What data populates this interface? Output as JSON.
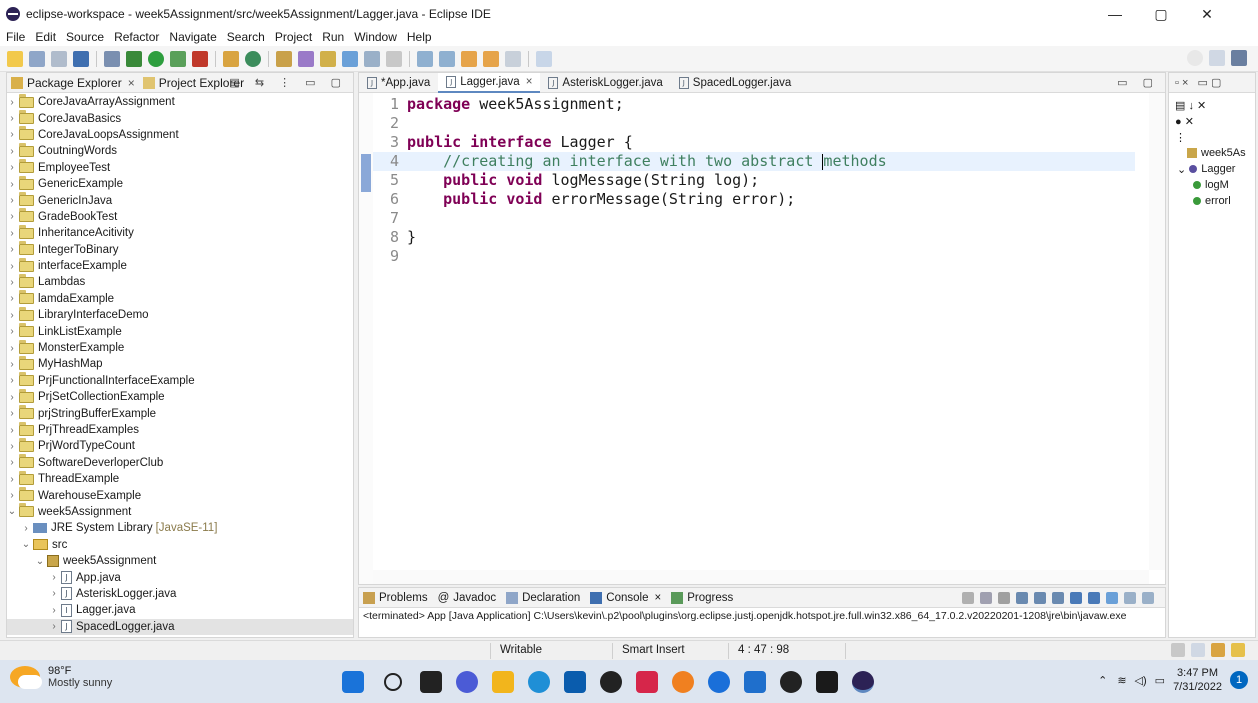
{
  "window": {
    "title": "eclipse-workspace - week5Assignment/src/week5Assignment/Lagger.java - Eclipse IDE",
    "minimize": "—",
    "maximize": "▢",
    "close": "✕"
  },
  "menu": [
    "File",
    "Edit",
    "Source",
    "Refactor",
    "Navigate",
    "Search",
    "Project",
    "Run",
    "Window",
    "Help"
  ],
  "left_panel": {
    "tabs": [
      {
        "label": "Package Explorer",
        "close": "×"
      },
      {
        "label": "Project Explorer",
        "close": ""
      }
    ],
    "projects": [
      "CoreJavaArrayAssignment",
      "CoreJavaBasics",
      "CoreJavaLoopsAssignment",
      "CoutningWords",
      "EmployeeTest",
      "GenericExample",
      "GenericInJava",
      "GradeBookTest",
      "InheritanceAcitivity",
      "IntegerToBinary",
      "interfaceExample",
      "Lambdas",
      "lamdaExample",
      "LibraryInterfaceDemo",
      "LinkListExample",
      "MonsterExample",
      "MyHashMap",
      "PrjFunctionalInterfaceExample",
      "PrjSetCollectionExample",
      "prjStringBufferExample",
      "PrjThreadExamples",
      "PrjWordTypeCount",
      "SoftwareDeverloperClub",
      "ThreadExample",
      "WarehouseExample"
    ],
    "open_project": "week5Assignment",
    "jre": "JRE System Library",
    "jre_tag": "[JavaSE-11]",
    "src": "src",
    "package": "week5Assignment",
    "files": [
      "App.java",
      "AsteriskLogger.java",
      "Lagger.java",
      "SpacedLogger.java"
    ]
  },
  "editor": {
    "tabs": [
      {
        "label": "*App.java",
        "close": ""
      },
      {
        "label": "Lagger.java",
        "close": "×"
      },
      {
        "label": "AsteriskLogger.java",
        "close": ""
      },
      {
        "label": "SpacedLogger.java",
        "close": ""
      }
    ],
    "lines": [
      {
        "num": "1",
        "kw": "package",
        "rest": " week5Assignment;"
      },
      {
        "num": "2",
        "kw": "",
        "rest": ""
      },
      {
        "num": "3",
        "kw": "public interface",
        "rest": " Lagger {"
      },
      {
        "num": "4",
        "comment_a": "    //creating an interface with two abstract ",
        "comment_b": "methods"
      },
      {
        "num": "5",
        "kw": "    public void",
        "rest": " logMessage(String log);"
      },
      {
        "num": "6",
        "kw": "    public void",
        "rest": " errorMessage(String error);"
      },
      {
        "num": "7",
        "kw": "",
        "rest": ""
      },
      {
        "num": "8",
        "kw": "",
        "rest": "}"
      },
      {
        "num": "9",
        "kw": "",
        "rest": ""
      }
    ]
  },
  "outline": {
    "items": [
      "week5As",
      "Lagger",
      "logM",
      "errorl"
    ]
  },
  "console": {
    "tabs": [
      "Problems",
      "Javadoc",
      "Declaration",
      "Console",
      "Progress"
    ],
    "tab_prefixes": [
      "",
      "@",
      "",
      "",
      ""
    ],
    "console_close": "×",
    "output": "<terminated> App [Java Application] C:\\Users\\kevin\\.p2\\pool\\plugins\\org.eclipse.justj.openjdk.hotspot.jre.full.win32.x86_64_17.0.2.v20220201-1208\\jre\\bin\\javaw.exe"
  },
  "status": {
    "mode": "Writable",
    "insert": "Smart Insert",
    "position": "4 : 47 : 98"
  },
  "taskbar": {
    "temp": "98°F",
    "weather": "Mostly sunny",
    "time": "3:47 PM",
    "date": "7/31/2022",
    "notifications": "1"
  }
}
